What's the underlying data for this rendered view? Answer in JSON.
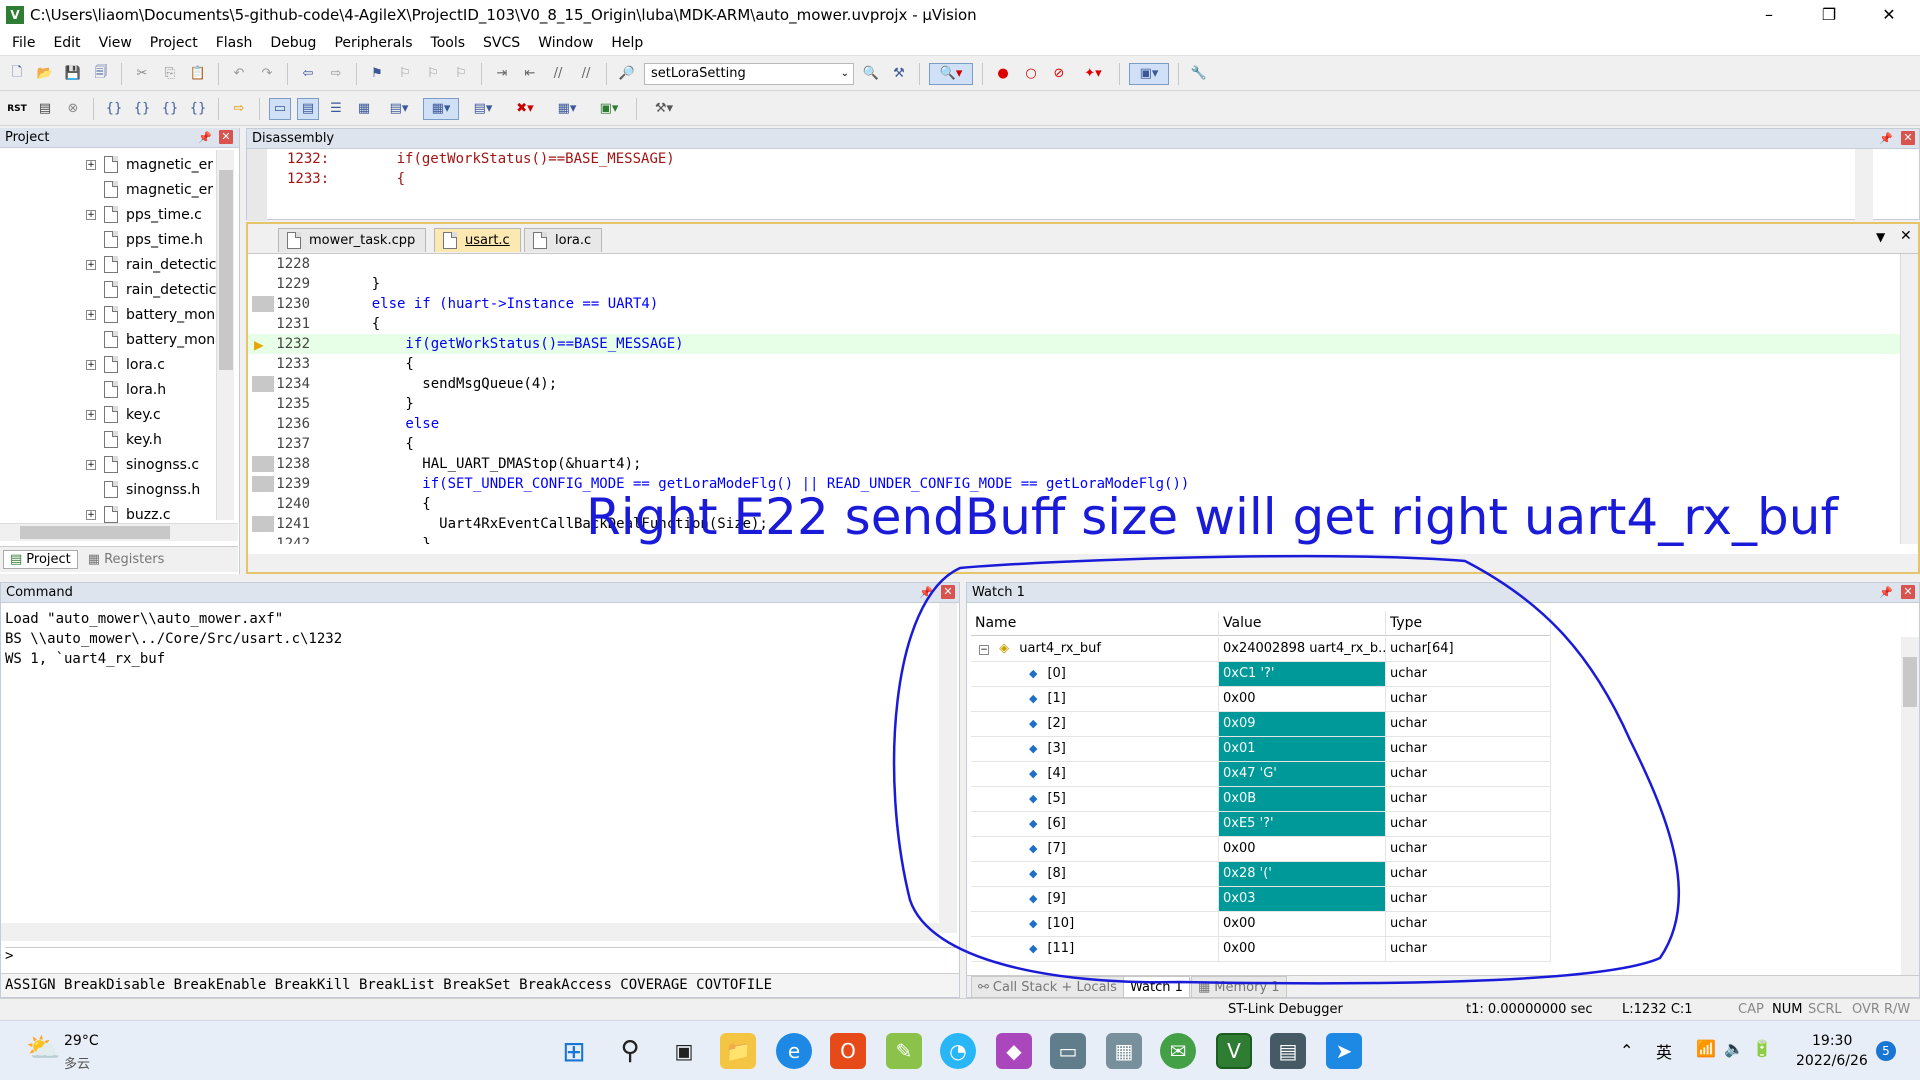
{
  "window": {
    "title": "C:\\Users\\liaom\\Documents\\5-github-code\\4-AgileX\\ProjectID_103\\V0_8_15_Origin\\luba\\MDK-ARM\\auto_mower.uvprojx - µVision",
    "minimize": "–",
    "maximize": "❐",
    "close": "✕"
  },
  "menu": [
    "File",
    "Edit",
    "View",
    "Project",
    "Flash",
    "Debug",
    "Peripherals",
    "Tools",
    "SVCS",
    "Window",
    "Help"
  ],
  "toolbar": {
    "target_combo": "setLoraSetting"
  },
  "project_panel": {
    "title": "Project",
    "files": [
      "magnetic_er",
      "magnetic_er",
      "pps_time.c",
      "pps_time.h",
      "rain_detectic",
      "rain_detectic",
      "battery_mon",
      "battery_mon",
      "lora.c",
      "lora.h",
      "key.c",
      "key.h",
      "sinognss.c",
      "sinognss.h",
      "buzz.c"
    ],
    "tabs": [
      "Project",
      "Registers"
    ]
  },
  "disassembly": {
    "title": "Disassembly",
    "lines": [
      {
        "num": "1232:",
        "code": "        if(getWorkStatus()==BASE_MESSAGE)"
      },
      {
        "num": "1233:",
        "code": "        {"
      }
    ]
  },
  "editor": {
    "tabs": [
      "mower_task.cpp",
      "usart.c",
      "lora.c"
    ],
    "lines": [
      {
        "num": "1228",
        "code": ""
      },
      {
        "num": "1229",
        "code": "    }"
      },
      {
        "num": "1230",
        "code": "    else if (huart->Instance == UART4)"
      },
      {
        "num": "1231",
        "code": "    {"
      },
      {
        "num": "1232",
        "code": "        if(getWorkStatus()==BASE_MESSAGE)"
      },
      {
        "num": "1233",
        "code": "        {"
      },
      {
        "num": "1234",
        "code": "          sendMsgQueue(4);"
      },
      {
        "num": "1235",
        "code": "        }"
      },
      {
        "num": "1236",
        "code": "        else"
      },
      {
        "num": "1237",
        "code": "        {"
      },
      {
        "num": "1238",
        "code": "          HAL_UART_DMAStop(&huart4);"
      },
      {
        "num": "1239",
        "code": "          if(SET_UNDER_CONFIG_MODE == getLoraModeFlg() || READ_UNDER_CONFIG_MODE == getLoraModeFlg())"
      },
      {
        "num": "1240",
        "code": "          {"
      },
      {
        "num": "1241",
        "code": "            Uart4RxEventCallBackDealFunction(Size);"
      },
      {
        "num": "1242",
        "code": "          }"
      }
    ]
  },
  "annotation": "Right E22 sendBuff size will get right uart4_rx_buf",
  "command": {
    "title": "Command",
    "lines": [
      "Load \"auto_mower\\\\auto_mower.axf\"",
      "BS \\\\auto_mower\\../Core/Src/usart.c\\1232",
      "WS 1, `uart4_rx_buf"
    ],
    "prompt": ">",
    "hints": "ASSIGN BreakDisable BreakEnable BreakKill BreakList BreakSet BreakAccess COVERAGE COVTOFILE"
  },
  "watch": {
    "title": "Watch 1",
    "headers": [
      "Name",
      "Value",
      "Type"
    ],
    "root": {
      "name": "uart4_rx_buf",
      "value": "0x24002898 uart4_rx_b...",
      "type": "uchar[64]"
    },
    "items": [
      {
        "name": "[0]",
        "value": "0xC1 '?'",
        "type": "uchar",
        "changed": true
      },
      {
        "name": "[1]",
        "value": "0x00",
        "type": "uchar",
        "changed": false
      },
      {
        "name": "[2]",
        "value": "0x09",
        "type": "uchar",
        "changed": true
      },
      {
        "name": "[3]",
        "value": "0x01",
        "type": "uchar",
        "changed": true
      },
      {
        "name": "[4]",
        "value": "0x47 'G'",
        "type": "uchar",
        "changed": true
      },
      {
        "name": "[5]",
        "value": "0x0B",
        "type": "uchar",
        "changed": true
      },
      {
        "name": "[6]",
        "value": "0xE5 '?'",
        "type": "uchar",
        "changed": true
      },
      {
        "name": "[7]",
        "value": "0x00",
        "type": "uchar",
        "changed": false
      },
      {
        "name": "[8]",
        "value": "0x28 '('",
        "type": "uchar",
        "changed": true
      },
      {
        "name": "[9]",
        "value": "0x03",
        "type": "uchar",
        "changed": true
      },
      {
        "name": "[10]",
        "value": "0x00",
        "type": "uchar",
        "changed": false
      },
      {
        "name": "[11]",
        "value": "0x00",
        "type": "uchar",
        "changed": false
      }
    ],
    "tabs": [
      "Call Stack + Locals",
      "Watch 1",
      "Memory 1"
    ]
  },
  "statusbar": {
    "debugger": "ST-Link Debugger",
    "time": "t1: 0.00000000 sec",
    "position": "L:1232 C:1",
    "indicators": [
      "CAP",
      "NUM",
      "SCRL",
      "OVR",
      "R/W"
    ]
  },
  "taskbar": {
    "weather_temp": "29°C",
    "weather_desc": "多云",
    "ime": "英",
    "time": "19:30",
    "date": "2022/6/26",
    "notifications": "5"
  },
  "colors": {
    "changed_value_bg": "#009999",
    "annotation": "#1a1ad9",
    "current_line_bg": "#e6ffe6"
  }
}
